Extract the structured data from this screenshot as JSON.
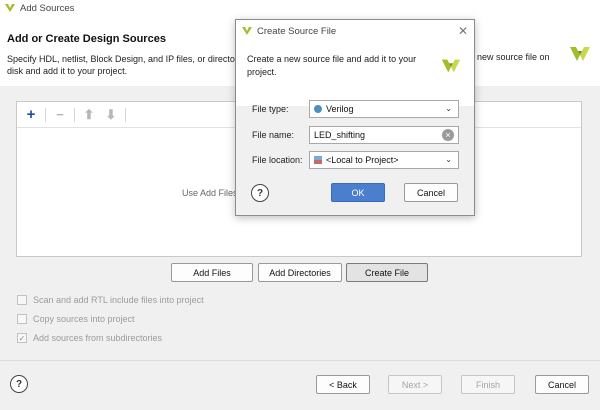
{
  "window": {
    "title": "Add Sources"
  },
  "page": {
    "heading": "Add or Create Design Sources",
    "description_line1": "Specify HDL, netlist, Block Design, and IP files, or directori",
    "description_right": "new source file on",
    "description_line2": "disk and add it to your project."
  },
  "files_panel": {
    "empty_hint": "Use Add Files"
  },
  "actions": {
    "add_files": "Add Files",
    "add_directories": "Add Directories",
    "create_file": "Create File"
  },
  "options": [
    {
      "label": "Scan and add RTL include files into project",
      "checked": false
    },
    {
      "label": "Copy sources into project",
      "checked": false
    },
    {
      "label": "Add sources from subdirectories",
      "checked": true
    }
  ],
  "footer": {
    "back": "< Back",
    "next": "Next >",
    "finish": "Finish",
    "cancel": "Cancel"
  },
  "dialog": {
    "title": "Create Source File",
    "description": "Create a new source file and add it to your project.",
    "file_type_label": "File type:",
    "file_type_value": "Verilog",
    "file_name_label": "File name:",
    "file_name_value": "LED_shifting",
    "file_location_label": "File location:",
    "file_location_value": "<Local to Project>",
    "ok": "OK",
    "cancel": "Cancel"
  },
  "colors": {
    "accent": "#4a7fcf",
    "logo_green": "#9fbf2a"
  },
  "icons": [
    "vivado-logo-icon",
    "add-icon",
    "remove-icon",
    "move-up-icon",
    "move-down-icon",
    "help-icon",
    "close-icon",
    "chevron-down-icon",
    "clear-icon",
    "verilog-icon",
    "folder-icon"
  ]
}
